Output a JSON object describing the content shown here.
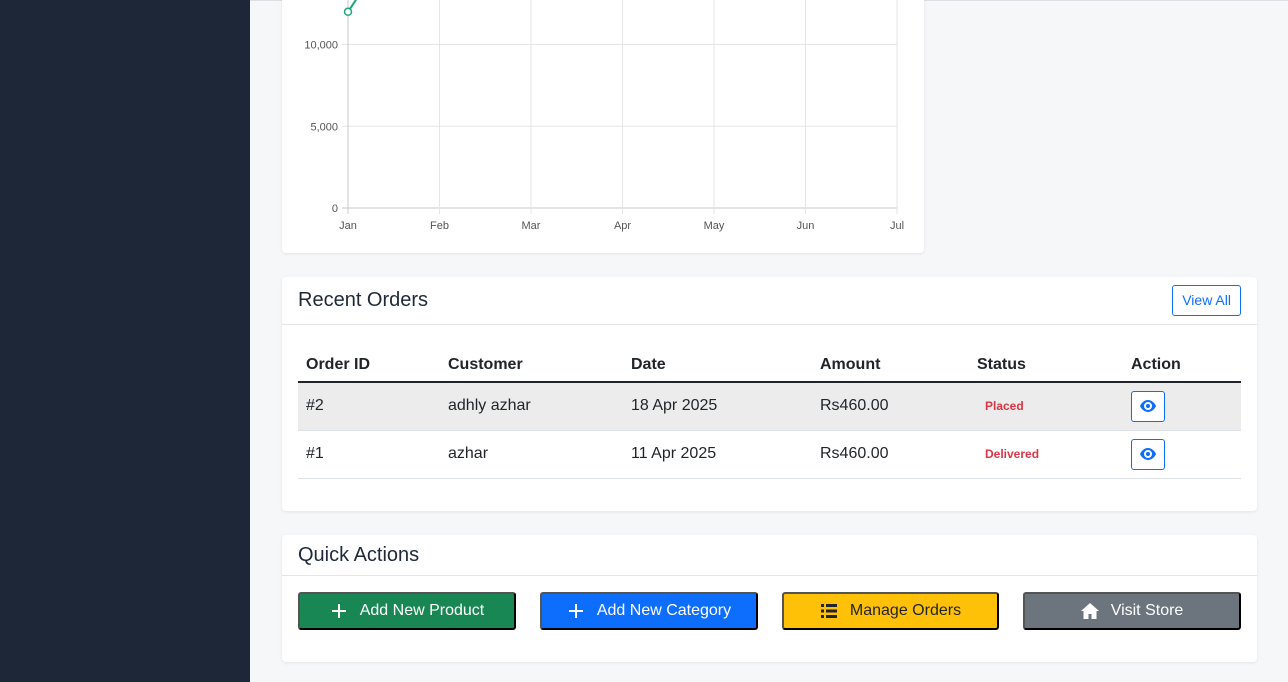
{
  "sales_chart": {
    "chart_data": {
      "type": "line",
      "categories": [
        "Jan",
        "Feb",
        "Mar",
        "Apr",
        "May",
        "Jun",
        "Jul"
      ],
      "series": [
        {
          "values": [
            12000,
            null,
            null,
            null,
            null,
            null,
            null
          ]
        }
      ],
      "y_ticks": [
        "0",
        "5,000",
        "10,000"
      ],
      "ylim": [
        0,
        15000
      ],
      "grid": true,
      "line_color": "#20a47b"
    }
  },
  "recent_orders": {
    "title": "Recent Orders",
    "view_all_label": "View All",
    "columns": [
      "Order ID",
      "Customer",
      "Date",
      "Amount",
      "Status",
      "Action"
    ],
    "rows": [
      {
        "order_id": "#2",
        "customer": "adhly azhar",
        "date": "18 Apr 2025",
        "amount": "Rs460.00",
        "status": "Placed"
      },
      {
        "order_id": "#1",
        "customer": "azhar",
        "date": "11 Apr 2025",
        "amount": "Rs460.00",
        "status": "Delivered"
      }
    ],
    "status_color": "#dc3545"
  },
  "quick_actions": {
    "title": "Quick Actions",
    "buttons": [
      {
        "label": "Add New Product",
        "icon": "plus-icon",
        "color": "#198754"
      },
      {
        "label": "Add New Category",
        "icon": "plus-icon",
        "color": "#0d6efd"
      },
      {
        "label": "Manage Orders",
        "icon": "list-icon",
        "color": "#ffc107"
      },
      {
        "label": "Visit Store",
        "icon": "home-icon",
        "color": "#6c757d"
      }
    ]
  }
}
